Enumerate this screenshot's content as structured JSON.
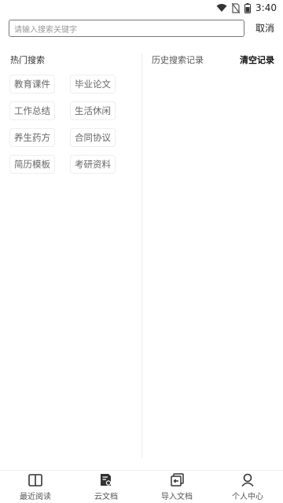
{
  "status_bar": {
    "time": "3:40",
    "icons": [
      "wifi-icon",
      "no-sim-icon",
      "battery-icon"
    ]
  },
  "search": {
    "placeholder": "请输入搜索关键字",
    "cancel_label": "取消"
  },
  "hot_searches": {
    "title": "热门搜索",
    "tags": [
      "教育课件",
      "毕业论文",
      "工作总结",
      "生活休闲",
      "养生药方",
      "合同协议",
      "简历模板",
      "考研资料"
    ]
  },
  "history": {
    "title": "历史搜索记录",
    "clear_label": "清空记录"
  },
  "bottom_nav": {
    "items": [
      {
        "label": "最近阅读",
        "icon": "book-icon"
      },
      {
        "label": "云文档",
        "icon": "cloud-document-icon"
      },
      {
        "label": "导入文档",
        "icon": "import-document-icon"
      },
      {
        "label": "个人中心",
        "icon": "user-icon"
      }
    ]
  }
}
